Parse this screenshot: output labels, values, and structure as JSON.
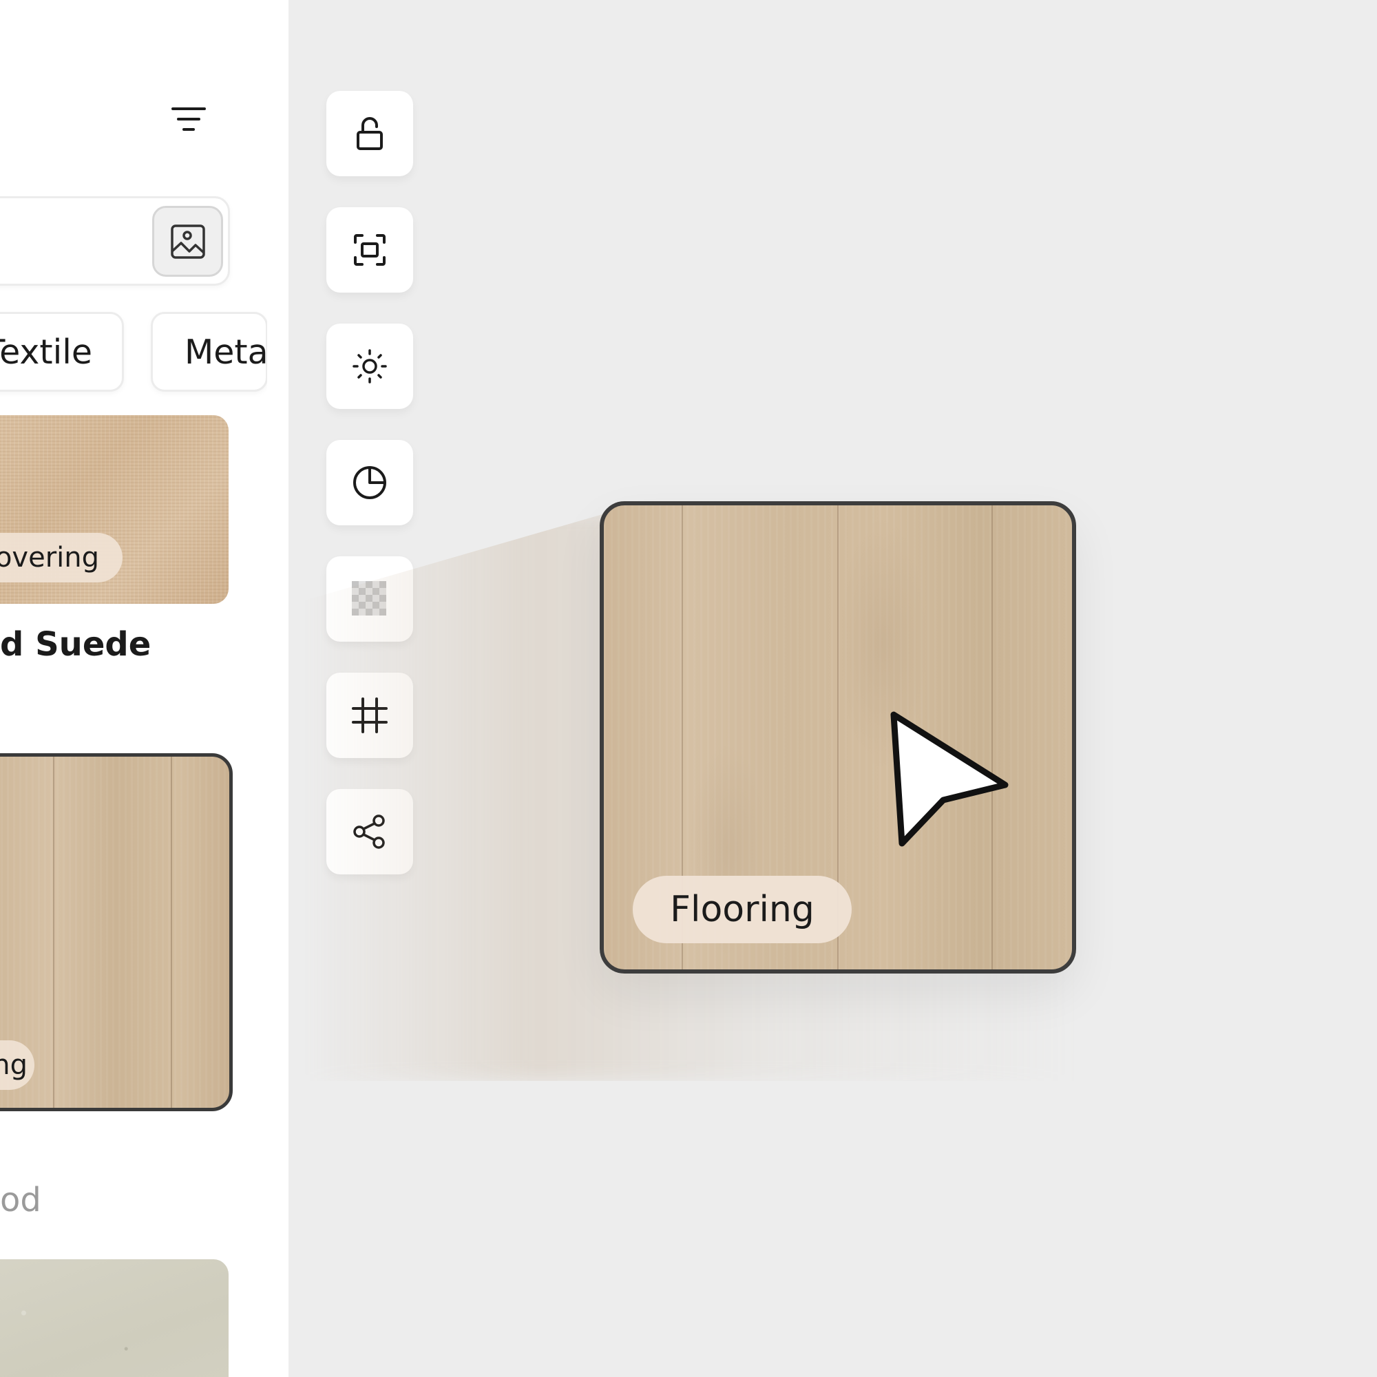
{
  "sidebar": {
    "filters": [
      {
        "label": "Textile"
      },
      {
        "label": "Meta"
      }
    ],
    "cards": [
      {
        "tag": "overing"
      },
      {
        "tag": "ng"
      }
    ],
    "card_title": "d Suede",
    "section_label": "od"
  },
  "toolbar": {
    "tools": [
      "lock-open-icon",
      "focus-frame-icon",
      "brightness-icon",
      "pie-icon",
      "transparency-icon",
      "crop-grid-icon",
      "share-icon"
    ]
  },
  "canvas": {
    "tile_tag": "Flooring"
  },
  "colors": {
    "background": "#ededed",
    "sidebar": "#ffffff",
    "tag_bg": "#f0e2d4",
    "tile_border": "#3d3d3d"
  }
}
